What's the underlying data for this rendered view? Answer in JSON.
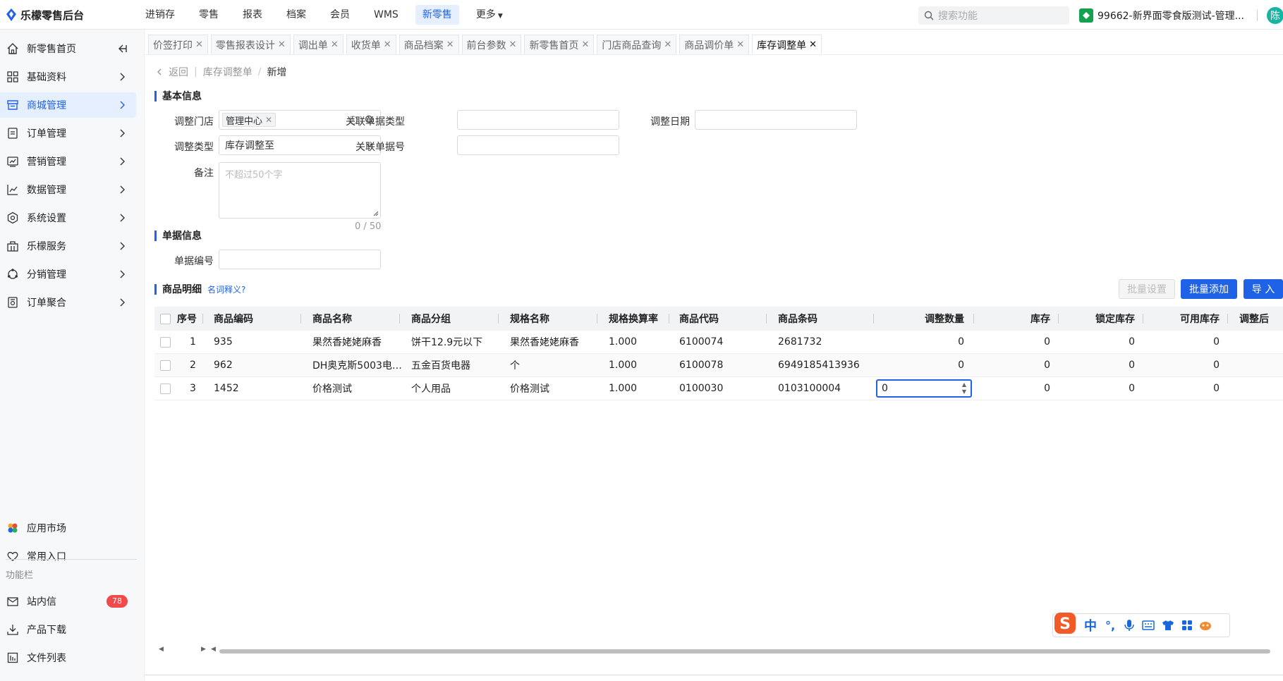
{
  "app": {
    "title": "乐檬零售后台"
  },
  "top_nav": {
    "items": [
      {
        "label": "进销存",
        "active": false
      },
      {
        "label": "零售",
        "active": false
      },
      {
        "label": "报表",
        "active": false
      },
      {
        "label": "档案",
        "active": false
      },
      {
        "label": "会员",
        "active": false
      },
      {
        "label": "WMS",
        "active": false
      },
      {
        "label": "新零售",
        "active": true
      },
      {
        "label": "更多",
        "active": false
      }
    ]
  },
  "search": {
    "placeholder": "搜索功能"
  },
  "store": {
    "label": "99662-新界面零食版测试-管理..."
  },
  "user": {
    "avatar_text": "陈"
  },
  "sidebar": {
    "items": [
      {
        "label": "新零售首页",
        "icon": "home-icon"
      },
      {
        "label": "基础资料",
        "icon": "grid-icon"
      },
      {
        "label": "商城管理",
        "icon": "store-icon",
        "active": true
      },
      {
        "label": "订单管理",
        "icon": "order-icon"
      },
      {
        "label": "营销管理",
        "icon": "marketing-icon"
      },
      {
        "label": "数据管理",
        "icon": "chart-icon"
      },
      {
        "label": "系统设置",
        "icon": "settings-icon"
      },
      {
        "label": "乐檬服务",
        "icon": "service-icon"
      },
      {
        "label": "分销管理",
        "icon": "distribution-icon"
      },
      {
        "label": "订单聚合",
        "icon": "aggregate-icon"
      }
    ],
    "bottom": [
      {
        "label": "应用市场",
        "icon": "app-market-icon"
      },
      {
        "label": "常用入口",
        "icon": "heart-icon"
      }
    ],
    "section_label": "功能栏",
    "tools": [
      {
        "label": "站内信",
        "icon": "mail-icon",
        "badge": "78"
      },
      {
        "label": "产品下载",
        "icon": "download-icon"
      },
      {
        "label": "文件列表",
        "icon": "file-list-icon"
      }
    ]
  },
  "tabs": [
    {
      "label": "价签打印",
      "active": false
    },
    {
      "label": "零售报表设计",
      "active": false
    },
    {
      "label": "调出单",
      "active": false
    },
    {
      "label": "收货单",
      "active": false
    },
    {
      "label": "商品档案",
      "active": false
    },
    {
      "label": "前台参数",
      "active": false
    },
    {
      "label": "新零售首页",
      "active": false
    },
    {
      "label": "门店商品查询",
      "active": false
    },
    {
      "label": "商品调价单",
      "active": false
    },
    {
      "label": "库存调整单",
      "active": true
    }
  ],
  "breadcrumb": {
    "back": "返回",
    "parent": "库存调整单",
    "current": "新增"
  },
  "basic_info": {
    "title": "基本信息",
    "store_label": "调整门店",
    "store_tag": "管理中心",
    "adjust_type_label": "调整类型",
    "adjust_type_value": "库存调整至",
    "remark_label": "备注",
    "remark_placeholder": "不超过50个字",
    "remark_counter": "0 / 50",
    "related_type_label": "关联单据类型",
    "related_no_label": "关联单据号",
    "adjust_date_label": "调整日期"
  },
  "doc_info": {
    "title": "单据信息",
    "doc_no_label": "单据编号"
  },
  "detail": {
    "title": "商品明细",
    "help_link": "名词释义?",
    "btn_batch_set": "批量设置",
    "btn_batch_add": "批量添加",
    "btn_import": "导 入"
  },
  "table": {
    "columns": [
      "序号",
      "商品编码",
      "商品名称",
      "商品分组",
      "规格名称",
      "规格换算率",
      "商品代码",
      "商品条码",
      "调整数量",
      "库存",
      "锁定库存",
      "可用库存",
      "调整后"
    ],
    "rows": [
      {
        "seq": "1",
        "code": "935",
        "name": "果然香姥姥麻香",
        "group": "饼干12.9元以下",
        "spec": "果然香姥姥麻香",
        "rate": "1.000",
        "item_code": "6100074",
        "barcode": "2681732",
        "adjust_qty": "0",
        "stock": "0",
        "locked": "0",
        "available": "0"
      },
      {
        "seq": "2",
        "code": "962",
        "name": "DH奥克斯5003电…",
        "group": "五金百货电器",
        "spec": "个",
        "rate": "1.000",
        "item_code": "6100078",
        "barcode": "6949185413936",
        "adjust_qty": "0",
        "stock": "0",
        "locked": "0",
        "available": "0"
      },
      {
        "seq": "3",
        "code": "1452",
        "name": "价格测试",
        "group": "个人用品",
        "spec": "价格测试",
        "rate": "1.000",
        "item_code": "0100030",
        "barcode": "0103100004",
        "adjust_qty": "0",
        "stock": "0",
        "locked": "0",
        "available": "0"
      }
    ]
  },
  "ime": {
    "lang": "中"
  },
  "colors": {
    "primary": "#2062e6",
    "active_bg": "#e6efff",
    "badge": "#f04a4a"
  }
}
